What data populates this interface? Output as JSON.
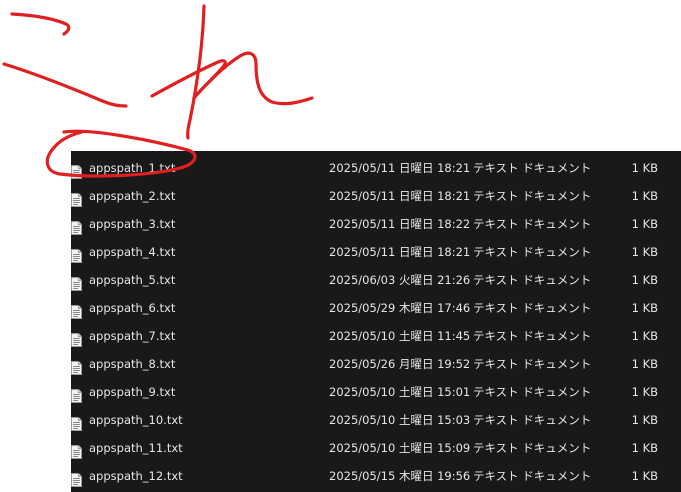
{
  "files": [
    {
      "name": "appspath_1.txt",
      "date": "2025/05/11 日曜日 18:21",
      "type": "テキスト ドキュメント",
      "size": "1 KB"
    },
    {
      "name": "appspath_2.txt",
      "date": "2025/05/11 日曜日 18:21",
      "type": "テキスト ドキュメント",
      "size": "1 KB"
    },
    {
      "name": "appspath_3.txt",
      "date": "2025/05/11 日曜日 18:22",
      "type": "テキスト ドキュメント",
      "size": "1 KB"
    },
    {
      "name": "appspath_4.txt",
      "date": "2025/05/11 日曜日 18:21",
      "type": "テキスト ドキュメント",
      "size": "1 KB"
    },
    {
      "name": "appspath_5.txt",
      "date": "2025/06/03 火曜日 21:26",
      "type": "テキスト ドキュメント",
      "size": "1 KB"
    },
    {
      "name": "appspath_6.txt",
      "date": "2025/05/29 木曜日 17:46",
      "type": "テキスト ドキュメント",
      "size": "1 KB"
    },
    {
      "name": "appspath_7.txt",
      "date": "2025/05/10 土曜日 11:45",
      "type": "テキスト ドキュメント",
      "size": "1 KB"
    },
    {
      "name": "appspath_8.txt",
      "date": "2025/05/26 月曜日 19:52",
      "type": "テキスト ドキュメント",
      "size": "1 KB"
    },
    {
      "name": "appspath_9.txt",
      "date": "2025/05/10 土曜日 15:01",
      "type": "テキスト ドキュメント",
      "size": "1 KB"
    },
    {
      "name": "appspath_10.txt",
      "date": "2025/05/10 土曜日 15:03",
      "type": "テキスト ドキュメント",
      "size": "1 KB"
    },
    {
      "name": "appspath_11.txt",
      "date": "2025/05/10 土曜日 15:09",
      "type": "テキスト ドキュメント",
      "size": "1 KB"
    },
    {
      "name": "appspath_12.txt",
      "date": "2025/05/15 木曜日 19:56",
      "type": "テキスト ドキュメント",
      "size": "1 KB"
    }
  ],
  "annotation": {
    "text": "これ",
    "color": "#e02020"
  },
  "colors": {
    "list_background": "#191919",
    "text": "#e6e6e6"
  }
}
